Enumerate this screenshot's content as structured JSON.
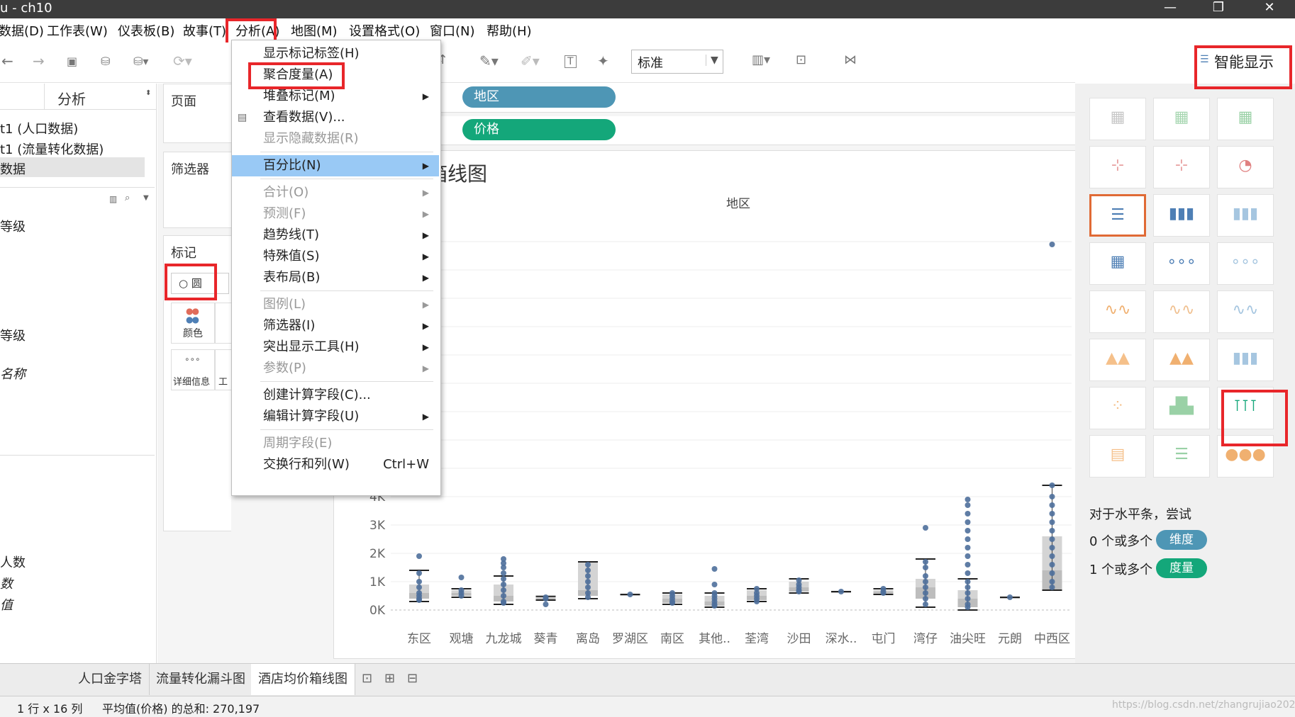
{
  "window": {
    "title": "u - ch10",
    "minimize": "—",
    "restore": "❐",
    "close": "✕"
  },
  "menubar": {
    "data": "数据(D)",
    "worksheet": "工作表(W)",
    "dashboard": "仪表板(B)",
    "story": "故事(T)",
    "analysis": "分析(A)",
    "map": "地图(M)",
    "format": "设置格式(O)",
    "window": "窗口(N)",
    "help": "帮助(H)"
  },
  "toolbar": {
    "fit_value": "标准"
  },
  "left_panel": {
    "tab_analysis": "分析",
    "datasources": [
      "t1 (人口数据)",
      "t1 (流量转化数据)",
      "数据"
    ],
    "fields": [
      {
        "text": "等级",
        "italic": false
      },
      {
        "text": "等级",
        "italic": false
      },
      {
        "text": "名称",
        "italic": true
      },
      {
        "text": "人数",
        "italic": false
      },
      {
        "text": "数",
        "italic": true
      },
      {
        "text": "值",
        "italic": true
      }
    ]
  },
  "cards": {
    "pages": "页面",
    "filters": "筛选器",
    "marks": "标记",
    "mark_type": "○ 圆",
    "color": "颜色",
    "detail": "详细信息",
    "other_short": "工"
  },
  "shelves": {
    "columns_pill": "地区",
    "rows_pill": "价格",
    "columns_color": "#4e96b5",
    "rows_color": "#14a77a"
  },
  "dropdown": {
    "items": [
      {
        "label": "显示标记标签(H)",
        "disabled": false,
        "submenu": false,
        "shortcut": ""
      },
      {
        "label": "聚合度量(A)",
        "disabled": false,
        "submenu": false,
        "shortcut": ""
      },
      {
        "label": "堆叠标记(M)",
        "disabled": false,
        "submenu": true,
        "shortcut": ""
      },
      {
        "label": "查看数据(V)...",
        "disabled": false,
        "submenu": false,
        "shortcut": ""
      },
      {
        "label": "显示隐藏数据(R)",
        "disabled": true,
        "submenu": false,
        "shortcut": ""
      },
      {
        "label": "百分比(N)",
        "disabled": false,
        "submenu": true,
        "shortcut": "",
        "highlighted": true
      },
      {
        "label": "合计(O)",
        "disabled": true,
        "submenu": true,
        "shortcut": ""
      },
      {
        "label": "预测(F)",
        "disabled": true,
        "submenu": true,
        "shortcut": ""
      },
      {
        "label": "趋势线(T)",
        "disabled": false,
        "submenu": true,
        "shortcut": ""
      },
      {
        "label": "特殊值(S)",
        "disabled": false,
        "submenu": true,
        "shortcut": ""
      },
      {
        "label": "表布局(B)",
        "disabled": false,
        "submenu": true,
        "shortcut": ""
      },
      {
        "label": "图例(L)",
        "disabled": true,
        "submenu": true,
        "shortcut": ""
      },
      {
        "label": "筛选器(I)",
        "disabled": false,
        "submenu": true,
        "shortcut": ""
      },
      {
        "label": "突出显示工具(H)",
        "disabled": false,
        "submenu": true,
        "shortcut": ""
      },
      {
        "label": "参数(P)",
        "disabled": true,
        "submenu": true,
        "shortcut": ""
      },
      {
        "label": "创建计算字段(C)...",
        "disabled": false,
        "submenu": false,
        "shortcut": ""
      },
      {
        "label": "编辑计算字段(U)",
        "disabled": false,
        "submenu": true,
        "shortcut": ""
      },
      {
        "label": "周期字段(E)",
        "disabled": true,
        "submenu": false,
        "shortcut": ""
      },
      {
        "label": "交换行和列(W)",
        "disabled": false,
        "submenu": false,
        "shortcut": "Ctrl+W"
      }
    ]
  },
  "chart_data": {
    "type": "boxplot",
    "title": "箱线图",
    "xlabel": "地区",
    "categories": [
      "东区",
      "观塘",
      "九龙城",
      "葵青",
      "离岛",
      "罗湖区",
      "南区",
      "其他..",
      "荃湾",
      "沙田",
      "深水..",
      "屯门",
      "湾仔",
      "油尖旺",
      "元朗",
      "中西区"
    ],
    "y_ticks": [
      "0K",
      "1K",
      "2K",
      "3K",
      "4K"
    ],
    "y_tick_values": [
      0,
      1000,
      2000,
      3000,
      4000
    ],
    "ylim": [
      0,
      13000
    ],
    "boxes": [
      {
        "min": 300,
        "q1": 400,
        "median": 600,
        "q3": 900,
        "max": 1400,
        "points": [
          1900,
          1300,
          1000,
          800,
          600,
          500,
          400,
          350
        ]
      },
      {
        "min": 450,
        "q1": 500,
        "median": 600,
        "q3": 700,
        "max": 750,
        "points": [
          1150,
          700,
          600,
          500
        ]
      },
      {
        "min": 200,
        "q1": 300,
        "median": 500,
        "q3": 900,
        "max": 1200,
        "points": [
          1800,
          1650,
          1500,
          1300,
          1100,
          900,
          700,
          500,
          300,
          250
        ]
      },
      {
        "min": 350,
        "q1": 380,
        "median": 420,
        "q3": 450,
        "max": 480,
        "points": [
          450,
          400,
          200
        ]
      },
      {
        "min": 400,
        "q1": 500,
        "median": 700,
        "q3": 1700,
        "max": 1700,
        "points": [
          1600,
          1400,
          1200,
          1000,
          800,
          600,
          450
        ]
      },
      {
        "min": 550,
        "q1": 550,
        "median": 550,
        "q3": 550,
        "max": 550,
        "points": [
          550
        ]
      },
      {
        "min": 200,
        "q1": 250,
        "median": 400,
        "q3": 550,
        "max": 600,
        "points": [
          600,
          500,
          400,
          300,
          250
        ]
      },
      {
        "min": 100,
        "q1": 150,
        "median": 300,
        "q3": 500,
        "max": 600,
        "points": [
          1450,
          900,
          600,
          500,
          400,
          300,
          200,
          150
        ]
      },
      {
        "min": 300,
        "q1": 350,
        "median": 500,
        "q3": 700,
        "max": 750,
        "points": [
          750,
          600,
          500,
          400,
          300
        ]
      },
      {
        "min": 600,
        "q1": 650,
        "median": 800,
        "q3": 1000,
        "max": 1100,
        "points": [
          1050,
          900,
          800,
          700,
          650
        ]
      },
      {
        "min": 650,
        "q1": 650,
        "median": 650,
        "q3": 650,
        "max": 650,
        "points": [
          650
        ]
      },
      {
        "min": 550,
        "q1": 580,
        "median": 650,
        "q3": 700,
        "max": 750,
        "points": [
          750,
          650,
          600
        ]
      },
      {
        "min": 100,
        "q1": 400,
        "median": 800,
        "q3": 1100,
        "max": 1800,
        "points": [
          2900,
          1700,
          1500,
          1200,
          1000,
          800,
          600,
          400,
          200
        ]
      },
      {
        "min": 0,
        "q1": 100,
        "median": 400,
        "q3": 700,
        "max": 1100,
        "points": [
          3900,
          3700,
          3400,
          3100,
          2800,
          2500,
          2200,
          1900,
          1600,
          1300,
          1000,
          800,
          600,
          400,
          200,
          100
        ]
      },
      {
        "min": 450,
        "q1": 450,
        "median": 450,
        "q3": 450,
        "max": 450,
        "points": [
          450
        ]
      },
      {
        "min": 700,
        "q1": 700,
        "median": 1400,
        "q3": 2600,
        "max": 4400,
        "points": [
          12900,
          4400,
          4000,
          3700,
          3400,
          3100,
          2800,
          2500,
          2200,
          1900,
          1600,
          1300,
          1000,
          800
        ]
      }
    ]
  },
  "smart_show": {
    "title": "智能显示",
    "hint": "对于水平条，尝试",
    "dim_prefix": "0 个或多个",
    "dim_pill": "维度",
    "measure_prefix": "1 个或多个",
    "measure_pill": "度量",
    "dim_color": "#4e96b5",
    "measure_color": "#14a77a"
  },
  "bottom_tabs": [
    "人口金字塔",
    "流量转化漏斗图",
    "酒店均价箱线图"
  ],
  "status": {
    "rows_cols": "1 行 x 16 列",
    "sum": "平均值(价格) 的总和: 270,197",
    "watermark": "https://blog.csdn.net/zhangrujiao2020"
  }
}
